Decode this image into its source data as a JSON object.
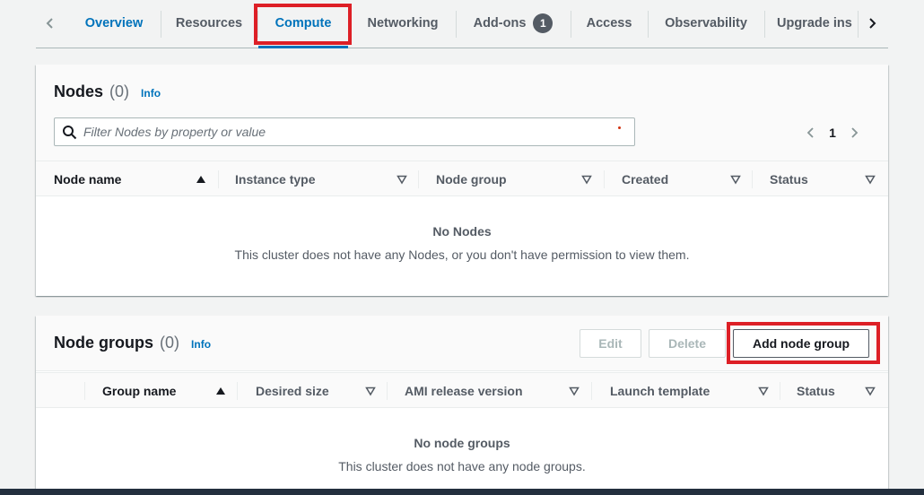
{
  "tabs": {
    "items": [
      {
        "label": "Overview"
      },
      {
        "label": "Resources"
      },
      {
        "label": "Compute"
      },
      {
        "label": "Networking"
      },
      {
        "label": "Add-ons",
        "badge": "1"
      },
      {
        "label": "Access"
      },
      {
        "label": "Observability"
      },
      {
        "label": "Upgrade ins"
      }
    ],
    "active": "Compute"
  },
  "nodes": {
    "title": "Nodes",
    "count": "(0)",
    "info": "Info",
    "filter_placeholder": "Filter Nodes by property or value",
    "page": "1",
    "columns": [
      "Node name",
      "Instance type",
      "Node group",
      "Created",
      "Status"
    ],
    "empty_title": "No Nodes",
    "empty_desc": "This cluster does not have any Nodes, or you don't have permission to view them."
  },
  "node_groups": {
    "title": "Node groups",
    "count": "(0)",
    "info": "Info",
    "edit_label": "Edit",
    "delete_label": "Delete",
    "add_label": "Add node group",
    "columns": [
      "Group name",
      "Desired size",
      "AMI release version",
      "Launch template",
      "Status"
    ],
    "empty_title": "No node groups",
    "empty_desc": "This cluster does not have any node groups."
  },
  "colors": {
    "accent": "#0073bb",
    "highlight": "#dd1f26",
    "text": "#16191f",
    "muted": "#545b64"
  }
}
